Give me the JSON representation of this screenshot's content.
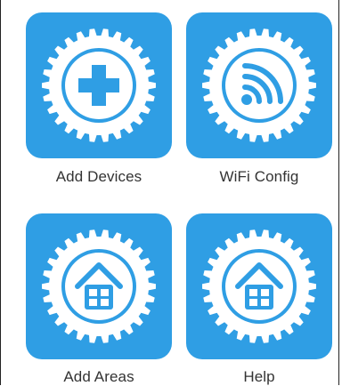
{
  "grid": {
    "items": [
      {
        "label": "Add Devices",
        "icon": "plus-icon"
      },
      {
        "label": "WiFi Config",
        "icon": "wifi-icon"
      },
      {
        "label": "Add Areas",
        "icon": "house-icon"
      },
      {
        "label": "Help",
        "icon": "house-icon"
      }
    ]
  },
  "colors": {
    "tile": "#2f9ee4",
    "gear": "#ffffff",
    "label_text": "#333333"
  }
}
